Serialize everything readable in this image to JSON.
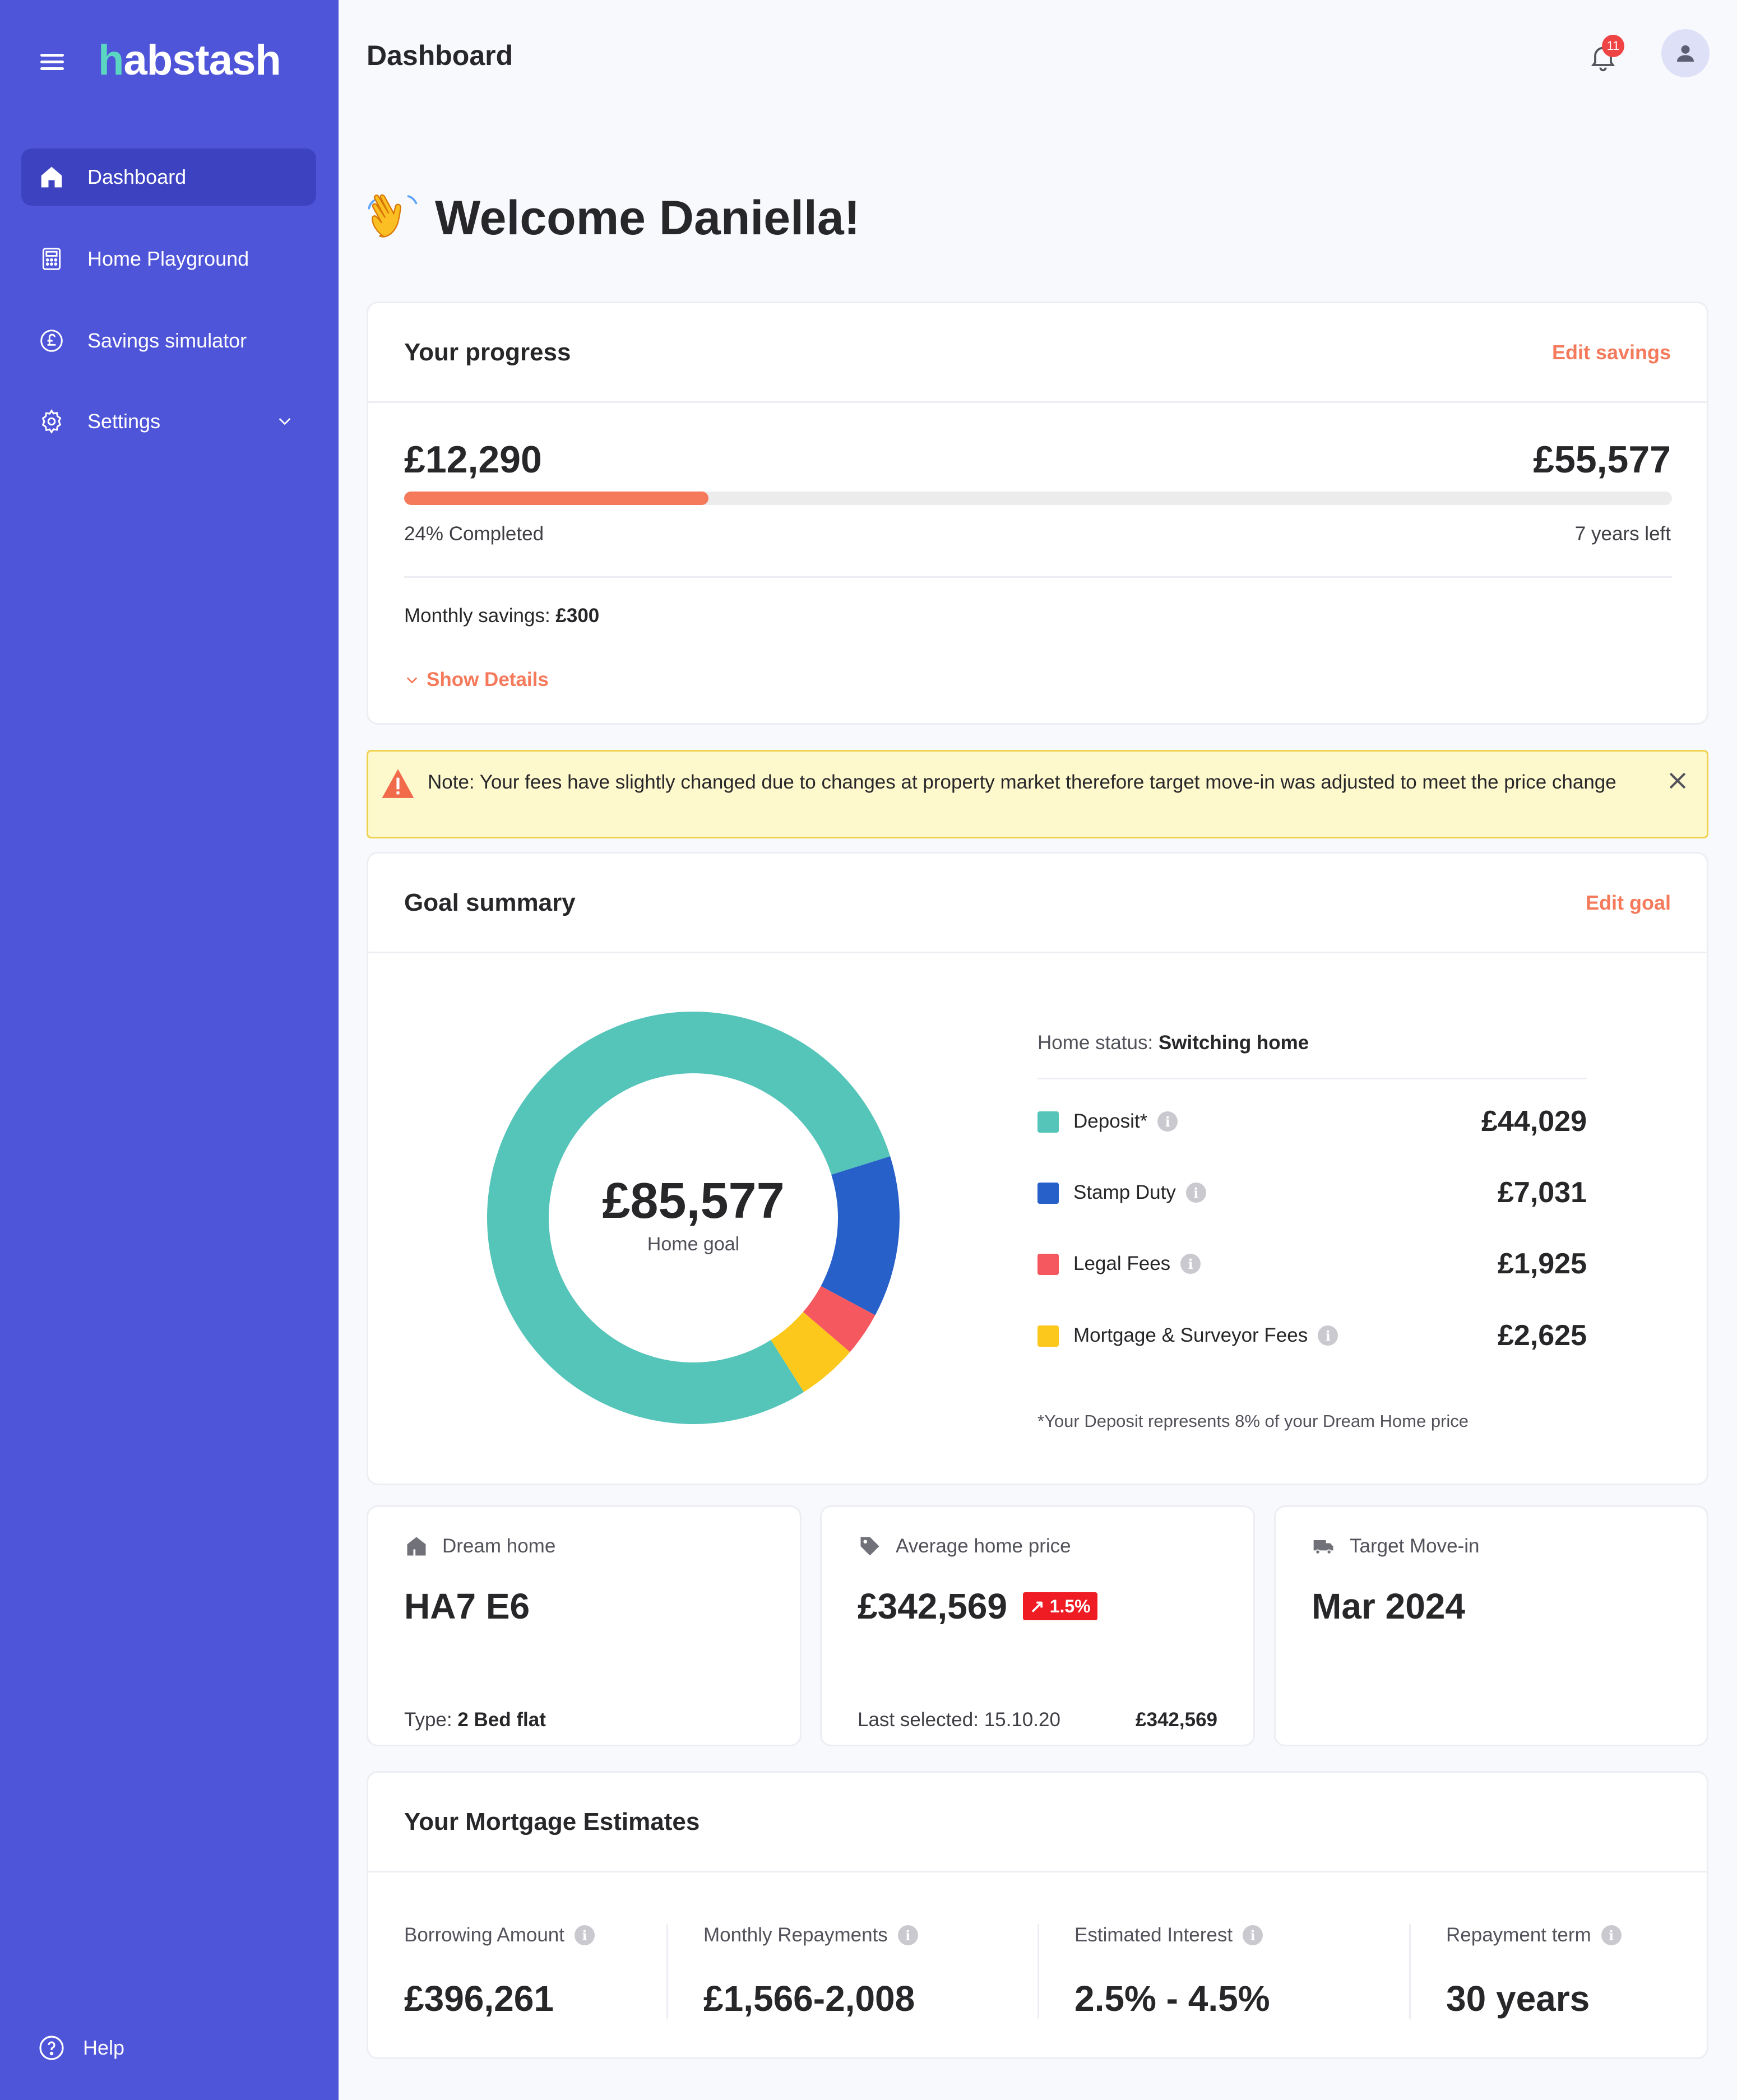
{
  "app": {
    "logo_mark": "h",
    "logo_text": "abstash"
  },
  "sidebar": {
    "items": [
      {
        "label": "Dashboard",
        "icon": "home-icon"
      },
      {
        "label": "Home Playground",
        "icon": "calculator-icon"
      },
      {
        "label": "Savings simulator",
        "icon": "pound-coin-icon"
      },
      {
        "label": "Settings",
        "icon": "gear-icon"
      }
    ],
    "help_label": "Help"
  },
  "header": {
    "title": "Dashboard",
    "notification_count": "11"
  },
  "welcome": {
    "text": "Welcome Daniella!"
  },
  "progress": {
    "title": "Your progress",
    "edit_label": "Edit savings",
    "current": "£12,290",
    "target": "£55,577",
    "percent": 24,
    "completed_text": "24% Completed",
    "years_left": "7 years left",
    "monthly_label": "Monthly savings: ",
    "monthly_value": "£300",
    "details_label": "Show Details"
  },
  "alert": {
    "text": "Note: Your fees have slightly changed due to changes at property market therefore target move-in was adjusted to meet the price change"
  },
  "goal": {
    "title": "Goal summary",
    "edit_label": "Edit goal",
    "total": "£85,577",
    "total_label": "Home goal",
    "status_label": "Home status: ",
    "status_value": "Switching home",
    "footnote": "*Your Deposit represents 8% of your Dream Home price",
    "items": [
      {
        "label": "Deposit*",
        "value": "£44,029",
        "color": "#55c4b9"
      },
      {
        "label": "Stamp Duty",
        "value": "£7,031",
        "color": "#2660c8"
      },
      {
        "label": "Legal Fees",
        "value": "£1,925",
        "color": "#f6585f"
      },
      {
        "label": "Mortgage & Surveyor Fees",
        "value": "£2,625",
        "color": "#fcc81c"
      }
    ]
  },
  "chart_data": {
    "type": "pie",
    "categories": [
      "Deposit*",
      "Stamp Duty",
      "Legal Fees",
      "Mortgage & Surveyor Fees"
    ],
    "values": [
      44029,
      7031,
      1925,
      2625
    ],
    "colors": [
      "#55c4b9",
      "#2660c8",
      "#f6585f",
      "#fcc81c"
    ],
    "title": ""
  },
  "cards": {
    "dream_home": {
      "label": "Dream home",
      "value": "HA7 E6",
      "type_label": "Type: ",
      "type_value": "2 Bed flat"
    },
    "avg_price": {
      "label": "Average home price",
      "value": "£342,569",
      "trend": "↗ 1.5%",
      "last_label": "Last selected: 15.10.20",
      "last_value": "£342,569"
    },
    "move_in": {
      "label": "Target Move-in",
      "value": "Mar 2024"
    }
  },
  "mortgage": {
    "title": "Your Mortgage Estimates",
    "items": [
      {
        "label": "Borrowing Amount",
        "value": "£396,261"
      },
      {
        "label": "Monthly Repayments",
        "value": "£1,566-2,008"
      },
      {
        "label": "Estimated Interest",
        "value": "2.5% - 4.5%"
      },
      {
        "label": "Repayment term",
        "value": "30 years"
      }
    ]
  }
}
